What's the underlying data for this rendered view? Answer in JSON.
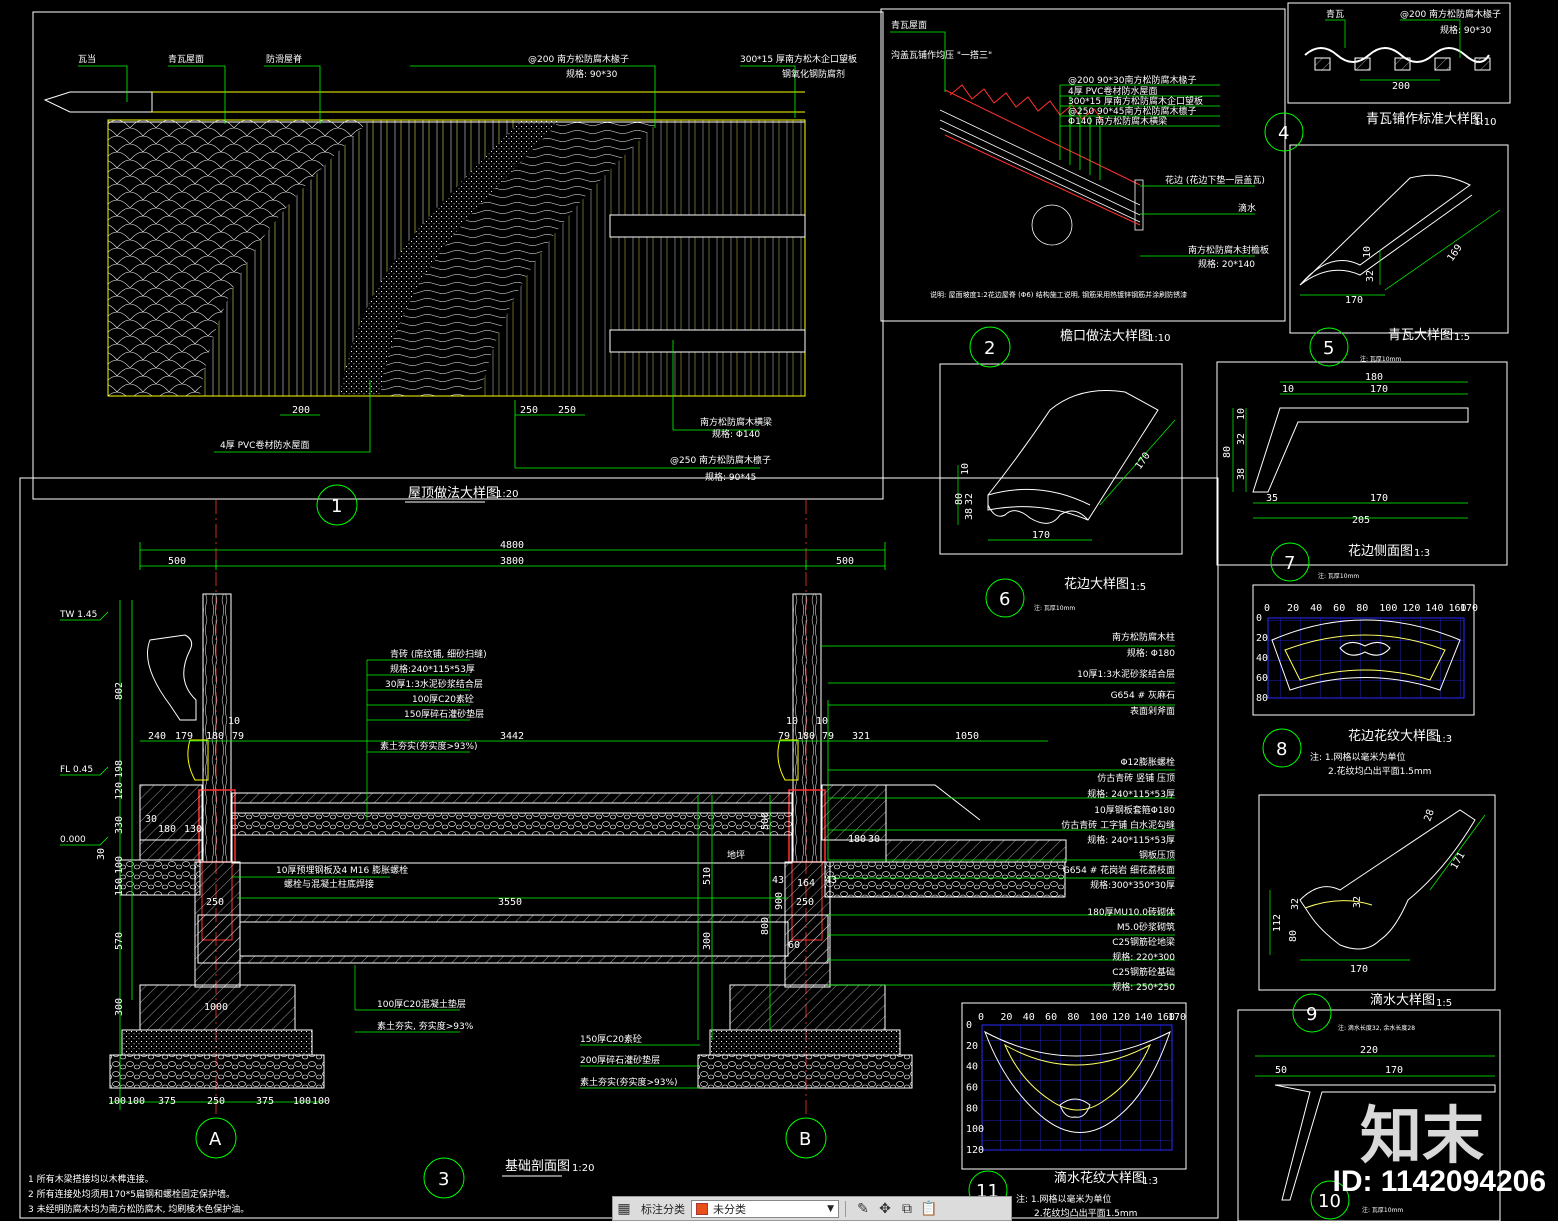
{
  "colors": {
    "frame": "#ffffff",
    "dim": "#00ff00",
    "red": "#ff2a2a",
    "wood": "#ffff00",
    "grid": "#2020ff",
    "cyan": "#00ffff"
  },
  "watermark": {
    "brand": "知末",
    "id": "ID: 1142094206"
  },
  "toolbar": {
    "label": "标注分类",
    "selected": "未分类",
    "icons": [
      "grid-icon",
      "pencil-icon",
      "move-icon",
      "copy-icon",
      "paste-icon"
    ]
  },
  "detail1": {
    "num": "1",
    "title": "屋顶做法大样图",
    "scale": "1:20",
    "labels": {
      "wadang": "瓦当",
      "qingwa": "青瓦屋面",
      "pvc_top": "防滑屋脊",
      "rafter200": "@200 南方松防腐木椽子",
      "rafter_spec": "规格: 90*30",
      "board": "300*15 厚南方松木企口望板",
      "board2": "钢氧化钢防腐剂",
      "pvc": "4厚 PVC卷材防水屋面",
      "beam": "南方松防腐木横梁",
      "beam_spec": "规格: Φ140",
      "purlin": "@250 南方松防腐木檩子",
      "purlin_spec": "规格: 90*45"
    },
    "dims": {
      "d200": "200",
      "d250a": "250",
      "d250b": "250"
    }
  },
  "detail2": {
    "num": "2",
    "title": "檐口做法大样图",
    "scale": "1:10",
    "labels": {
      "a": "青瓦屋面",
      "b": "沟盖瓦铺作均压 \"一搭三\"",
      "c1": "@200 90*30南方松防腐木椽子",
      "c2": "4厚 PVC卷材防水屋面",
      "c3": "300*15 厚南方松防腐木企口望板",
      "c4": "@250 90*45南方松防腐木檩子",
      "c5": "Φ140 南方松防腐木横梁",
      "d": "花边 (花边下垫一层盖瓦)",
      "e": "滴水",
      "f": "南方松防腐木封檐板",
      "f2": "规格: 20*140",
      "note": "说明: 屋面坡度1:2花边屋脊 (Φ6) 结构施工说明, 钢筋采用热镀锌钢筋并涂刷防锈漆"
    }
  },
  "detail3": {
    "num": "3",
    "title": "基础剖面图",
    "scale": "1:20",
    "notes": [
      "1  所有木梁搭接均以木榫连接。",
      "2  所有连接处均须用170*5扁钢和螺栓固定保护墙。",
      "3  未经明防腐木均为南方松防腐木, 均刷棱木色保护油。"
    ],
    "axisA": "A",
    "axisB": "B",
    "elev": {
      "tw": "TW 1.45",
      "fl": "FL 0.45",
      "zero": "0.000"
    },
    "dims_top": {
      "total": "4800",
      "left": "500",
      "mid": "3800",
      "right": "500"
    },
    "dims_mid": {
      "a": "240",
      "b": "179",
      "c": "180",
      "d": "79",
      "e": "3442",
      "f": "79",
      "g": "180",
      "h": "79",
      "i": "321",
      "j": "1050",
      "k": "10",
      "l": "10",
      "m": "10"
    },
    "dims_bot": {
      "a": "100",
      "b": "100",
      "c": "375",
      "d": "250",
      "e": "375",
      "f": "100",
      "g": "100",
      "w": "1000"
    },
    "dims_left": {
      "a": "802",
      "b": "198",
      "c": "120",
      "d": "330",
      "e": "30",
      "f": "100",
      "g": "150",
      "h": "570",
      "i": "300",
      "j": "180",
      "k": "130",
      "l": "30"
    },
    "dims_inner": {
      "w3550": "3550",
      "w250a": "250",
      "w250b": "250",
      "w164": "164",
      "w43a": "43",
      "w43b": "43",
      "h510": "510",
      "h500": "500",
      "h300": "300",
      "h800": "800",
      "h900": "900",
      "h60": "60",
      "h180": "180",
      "h30": "30"
    },
    "labels_left": {
      "l1": "青砖 (席纹铺, 细砂扫缝)",
      "l2": "规格:240*115*53厚",
      "l3": "30厚1:3水泥砂浆结合层",
      "l4": "100厚C20素砼",
      "l5": "150厚碎石灌砂垫层",
      "l6": "素土夯实(夯实度>93%)",
      "l7": "10厚预埋钢板及4 M16 膨胀螺栓",
      "l8": "螺栓与混凝土柱底焊接",
      "l9": "100厚C20混凝土垫层",
      "l10": "素土夯实, 夯实度>93%",
      "l11": "150厚C20素砼",
      "l12": "200厚碎石灌砂垫层",
      "l13": "素土夯实(夯实度>93%)",
      "l14": "地坪"
    },
    "labels_right": [
      "南方松防腐木柱",
      "规格: Φ180",
      "10厚1:3水泥砂浆结合层",
      "G654 # 灰麻石",
      "表面剁斧面",
      "Φ12膨胀螺栓",
      "仿古青砖 竖铺 压顶",
      "规格: 240*115*53厚",
      "10厚钢板套箍Φ180",
      "仿古青砖 工字铺 白水泥勾缝",
      "规格: 240*115*53厚",
      "钢板压顶",
      "G654 # 花岗岩 细花荔枝面",
      "规格:300*350*30厚",
      "180厚MU10.0砖砌体",
      "M5.0砂浆砌筑",
      "C25钢筋砼地梁",
      "规格: 220*300",
      "C25钢筋砼基础",
      "规格: 250*250"
    ]
  },
  "detail4": {
    "num": "4",
    "title": "青瓦铺作标准大样图",
    "scale": "1:10",
    "labels": {
      "a": "青瓦",
      "b": "@200 南方松防腐木椽子",
      "c": "规格: 90*30",
      "d": "200"
    }
  },
  "detail5": {
    "num": "5",
    "title": "青瓦大样图",
    "scale": "1:5",
    "note": "注: 瓦厚10mm",
    "dims": {
      "a": "170",
      "b": "32",
      "c": "10",
      "d": "169"
    }
  },
  "detail6": {
    "num": "6",
    "title": "花边大样图",
    "scale": "1:5",
    "note": "注: 瓦厚10mm",
    "dims": {
      "a": "170",
      "b": "38",
      "c": "32",
      "d": "80",
      "e": "10",
      "f": "170"
    }
  },
  "detail7": {
    "num": "7",
    "title": "花边侧面图",
    "scale": "1:3",
    "note": "注: 瓦厚10mm",
    "dims": {
      "a": "180",
      "b": "10",
      "c": "170",
      "d": "10",
      "e": "32",
      "f": "38",
      "g": "80",
      "h": "35",
      "i": "170",
      "j": "205"
    }
  },
  "detail8": {
    "num": "8",
    "title": "花边花纹大样图",
    "scale": "1:3",
    "notes": [
      "注: 1.网格以毫米为单位",
      "2.花纹均凸出平面1.5mm"
    ],
    "xticks": [
      "0",
      "20",
      "40",
      "60",
      "80",
      "100",
      "120",
      "140",
      "160",
      "170"
    ],
    "yticks": [
      "0",
      "20",
      "40",
      "60",
      "80"
    ]
  },
  "detail9": {
    "num": "9",
    "title": "滴水大样图",
    "scale": "1:5",
    "note": "注: 滴水长度32, 余水长度28",
    "dims": {
      "a": "28",
      "b": "171",
      "c": "32",
      "d": "32",
      "e": "112",
      "f": "80",
      "g": "170"
    }
  },
  "detail10": {
    "num": "10",
    "note": "注: 瓦厚10mm",
    "dims": {
      "a": "220",
      "b": "50",
      "c": "170"
    }
  },
  "detail11": {
    "num": "11",
    "title": "滴水花纹大样图",
    "scale": "1:3",
    "notes": [
      "注: 1.网格以毫米为单位",
      "2.花纹均凸出平面1.5mm"
    ],
    "xticks": [
      "0",
      "20",
      "40",
      "60",
      "80",
      "100",
      "120",
      "140",
      "160",
      "170"
    ],
    "yticks": [
      "0",
      "20",
      "40",
      "60",
      "80",
      "100",
      "120"
    ]
  }
}
